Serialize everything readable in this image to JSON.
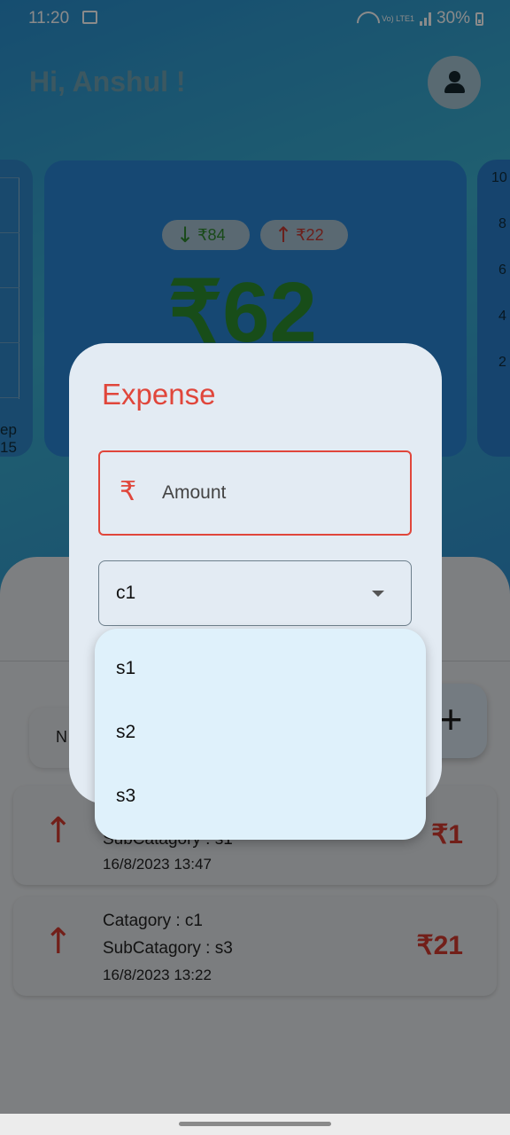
{
  "status_bar": {
    "time": "11:20",
    "lte_label": "Vo) LTE1",
    "battery": "30%"
  },
  "header": {
    "greeting": "Hi, Anshul !"
  },
  "summary": {
    "income": "₹84",
    "expense": "₹22",
    "balance": "₹62",
    "left_chart_label": "ep 15",
    "right_chart_ticks": [
      "10",
      "8",
      "6",
      "4",
      "2"
    ]
  },
  "list": {
    "chip_label": "N",
    "add_icon": "plus-icon",
    "transactions": [
      {
        "subcategory": "SubCatagory : s1",
        "datetime": "16/8/2023   13:47",
        "amount": "₹1"
      },
      {
        "category": "Catagory : c1",
        "subcategory": "SubCatagory : s3",
        "datetime": "16/8/2023   13:22",
        "amount": "₹21"
      }
    ]
  },
  "dialog": {
    "title": "Expense",
    "amount_icon": "rupee-icon",
    "amount_placeholder": "Amount",
    "category_value": "c1",
    "subcategory_options": [
      "s1",
      "s2",
      "s3"
    ]
  },
  "colors": {
    "accent": "#e0463b",
    "income": "#2f8a2f",
    "menu_bg": "#dff1fb",
    "dialog_bg": "#e3ebf3"
  }
}
